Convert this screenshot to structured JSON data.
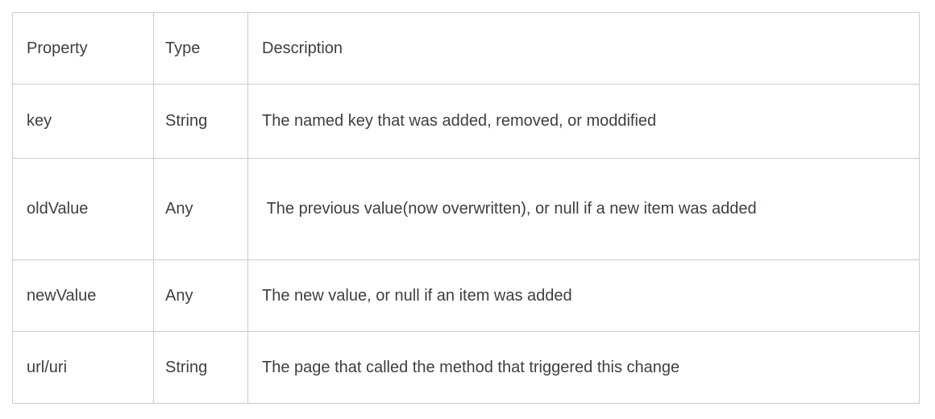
{
  "table": {
    "columns": [
      {
        "key": "property",
        "label": "Property"
      },
      {
        "key": "type",
        "label": "Type"
      },
      {
        "key": "description",
        "label": "Description"
      }
    ],
    "rows": [
      {
        "property": "key",
        "type": "String",
        "description": "The named key that was added, removed, or moddified"
      },
      {
        "property": "oldValue",
        "type": "Any",
        "description": " The previous value(now overwritten), or null if a new item was added"
      },
      {
        "property": "newValue",
        "type": "Any",
        "description": "The new value, or null if an item was added"
      },
      {
        "property": "url/uri",
        "type": "String",
        "description": "The page that called the method that triggered this change"
      }
    ]
  },
  "style": {
    "border_color": "#cccccc",
    "text_color": "#3c4043",
    "background_color": "#ffffff"
  }
}
